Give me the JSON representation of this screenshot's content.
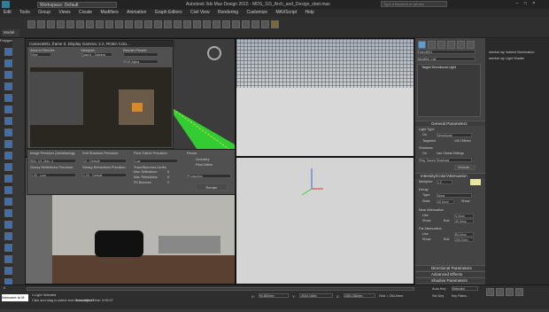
{
  "window": {
    "title": "Autodesk 3ds Max Design 2015 - MDS_115_Arch_and_Design_start.max",
    "workspace": "Workspace: Default",
    "search_placeholder": "Type a keyword or phrase"
  },
  "menu": [
    "Edit",
    "Tools",
    "Group",
    "Views",
    "Create",
    "Modifiers",
    "Animation",
    "Graph Editors",
    "Civil View",
    "Rendering",
    "Customize",
    "MAXScript",
    "Help"
  ],
  "left_tabs": [
    "Model",
    "Polygon M"
  ],
  "render_window": {
    "title": "Camera001, frame 0, Display Gamma: 2.2, RGBA Colo...",
    "area_label": "Area to Render:",
    "area_value": "View",
    "viewport_label": "Viewport:",
    "viewport_value": "Quad 4 - Camera",
    "preset_label": "Render Preset:",
    "channel_value": "RGB Alpha",
    "image_precision_label": "Image Precision (Antialiasing):",
    "image_precision_value": "Min: 1/4, Max: 4",
    "soft_shadows_label": "Soft Shadows Precision:",
    "soft_shadows_value": "1X - Default",
    "final_gather_label": "Final Gather Precision:",
    "final_gather_value": "Low",
    "glossy_refl_label": "Glossy Reflections Precision:",
    "glossy_refl_value": "1.0X - Low",
    "glossy_refr_label": "Glossy Refractions Precision:",
    "glossy_refr_value": "1.0X - Default",
    "trace_label": "Trace/Bounces Limits:",
    "max_reflections": "Max. Reflections:",
    "max_reflections_value": "6",
    "max_refractions": "Max. Refractions:",
    "max_refractions_value": "6",
    "fg_bounces": "FG Bounces:",
    "fg_bounces_value": "0",
    "reuse_label": "Reuse:",
    "geometry_label": "Geometry",
    "final_gather_check": "Final Gather",
    "production_value": "Production",
    "render_button": "Render"
  },
  "command_panel": {
    "object_name": "Direct001",
    "modifier_list": "Modifier List",
    "stack_item": "Target Directional Light",
    "general_parameters": "General Parameters",
    "light_type": "Light Type",
    "on_label": "On",
    "light_type_value": "Directional",
    "targeted_label": "Targeted",
    "targeted_value": "240.769mm",
    "shadows_label": "Shadows",
    "shadows_on": "On",
    "global_settings": "Use Global Settings",
    "shadow_type": "Ray Traced Shadows",
    "exclude_button": "Exclude...",
    "intensity_rollout": "Intensity/Color/Attenuation",
    "multiplier_label": "Multiplier:",
    "multiplier_value": "1.0",
    "decay_label": "Decay",
    "decay_type_label": "Type:",
    "decay_type_value": "None",
    "decay_start_label": "Start:",
    "decay_start_value": "40.0mm",
    "show_label": "Show",
    "near_atten": "Near Attenuation",
    "use_label": "Use",
    "near_start_value": "0.0mm",
    "near_end_value": "40.0mm",
    "far_atten": "Far Attenuation",
    "far_start_value": "80.0mm",
    "far_end_value": "200.0mm",
    "end_label": "End:",
    "directional_params": "Directional Parameters",
    "advanced_effects": "Advanced Effects",
    "shadow_params": "Shadow Parameters"
  },
  "right_panel": {
    "items": [
      "mental ray Indirect Illumination",
      "mental ray Light Shader"
    ]
  },
  "status": {
    "selection": "1 Light Selected",
    "prompt": "Click and drag to select and move objects",
    "translation": "Translation Time: 0:00:07",
    "x_label": "X:",
    "x_value": "94.883mm",
    "y_label": "Y:",
    "y_value": "-3034.168m",
    "z_label": "Z:",
    "z_value": "1554.266mm",
    "grid": "Grid = 254.0mm",
    "auto_key": "Auto Key",
    "selected": "Selected",
    "set_key": "Set Key",
    "key_filters": "Key Filters...",
    "frame": "0",
    "welcome": "Welcome to M"
  },
  "colors": {
    "accent": "#5a9fd4",
    "grid_green": "#33cc33",
    "light_yellow": "#e8e8a0",
    "viewport_bg": "#cfcfcf"
  }
}
